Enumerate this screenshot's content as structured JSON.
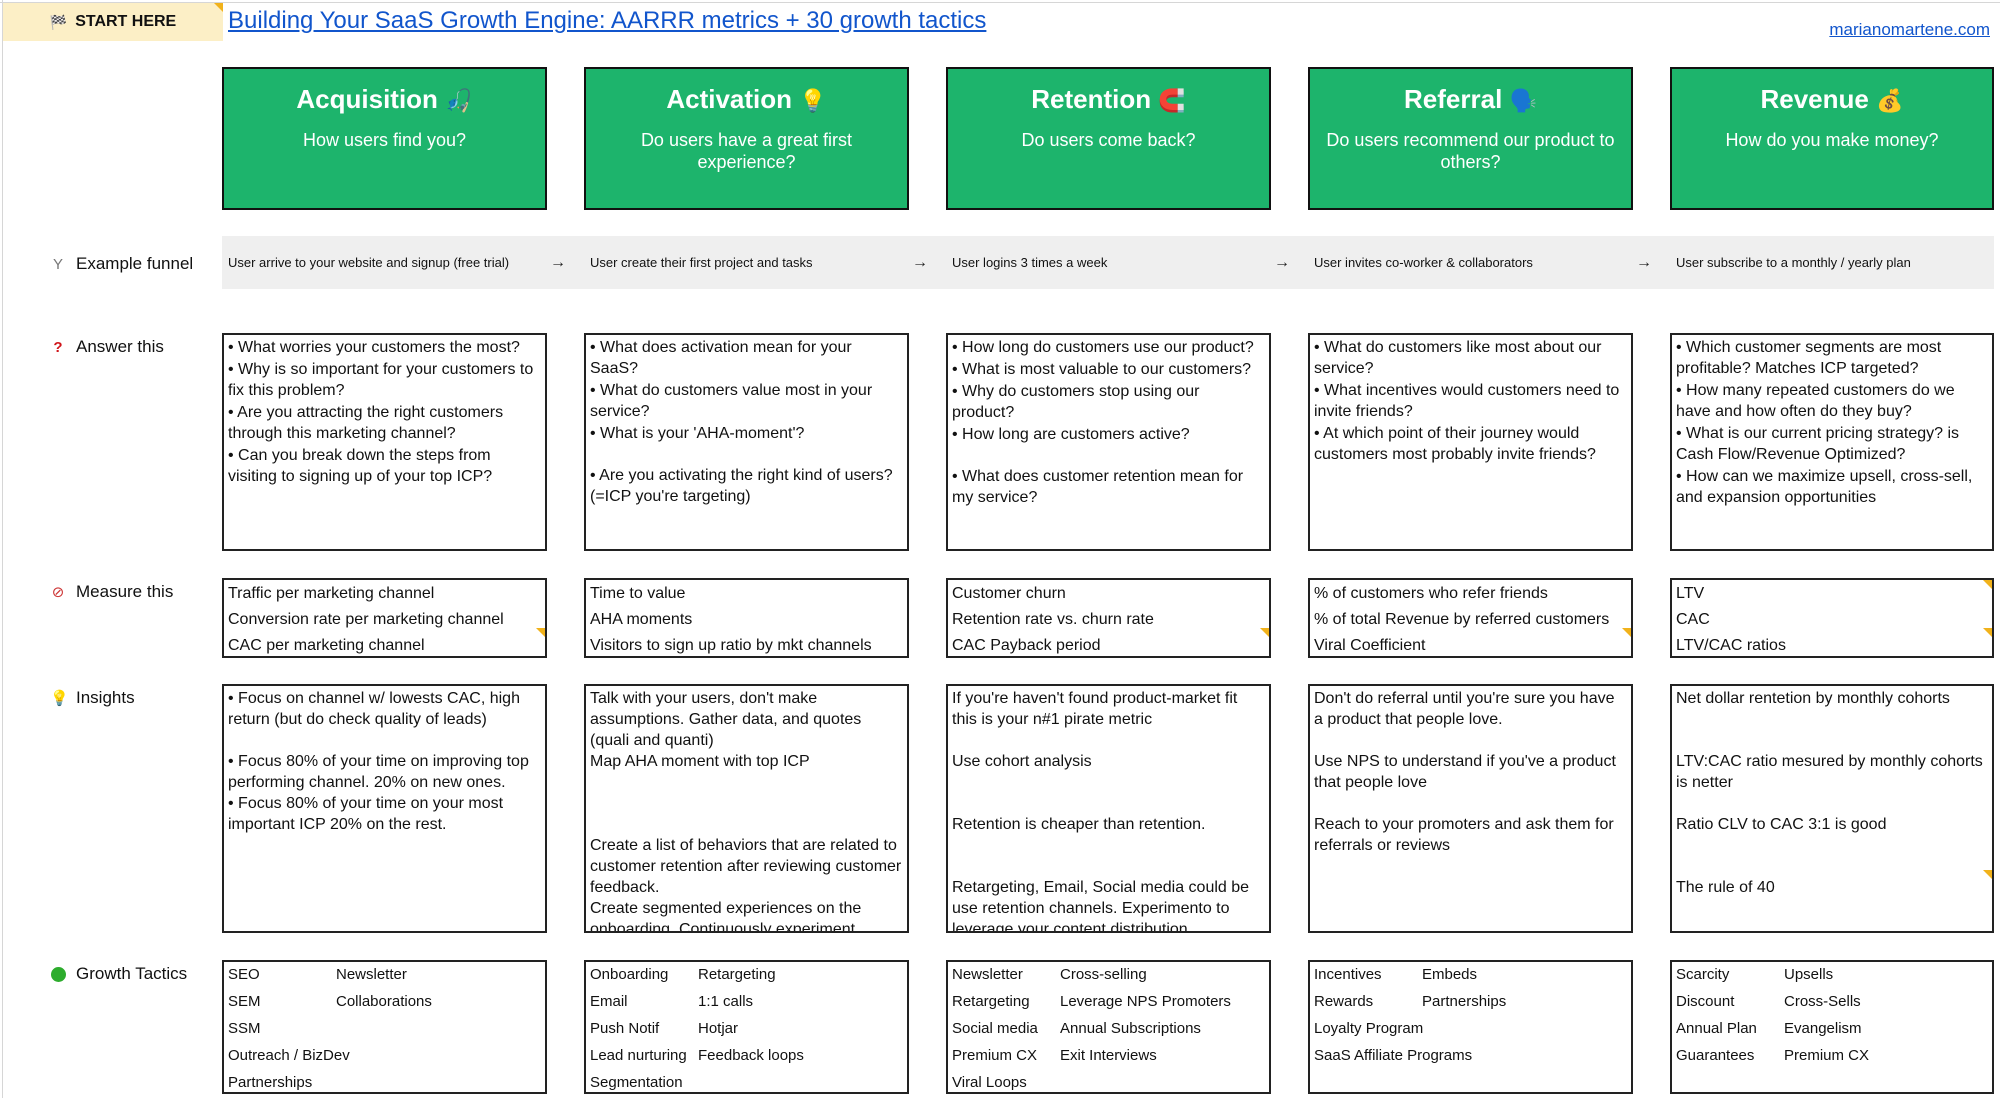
{
  "start_here": {
    "label": "START HERE",
    "icon": "checkered-flag"
  },
  "title": "Building Your SaaS Growth Engine: AARRR metrics + 30 growth tactics",
  "site_link": "marianomartene.com",
  "theme": {
    "card_green": "#1db46c",
    "link_blue": "#1155cc",
    "start_bg": "#fcefc6",
    "note_marker": "#f1b21b",
    "funnel_bg": "#efefef"
  },
  "row_labels": {
    "funnel": {
      "icon": "funnel-icon",
      "label": "Example funnel"
    },
    "answer": {
      "icon": "question-mark-icon",
      "label": "Answer this"
    },
    "measure": {
      "icon": "compass-icon",
      "label": "Measure this"
    },
    "insights": {
      "icon": "lightbulb-icon",
      "label": "Insights"
    },
    "growth": {
      "icon": "green-circle-icon",
      "label": "Growth Tactics"
    }
  },
  "stages": [
    {
      "name": "Acquisition",
      "emoji": "🎣",
      "question": "How users find you?",
      "funnel": "User arrive to your website and signup (free trial)",
      "answer": [
        "• What worries your customers the most?",
        "• Why is so important for your customers to fix this problem?",
        "• Are you attracting the right customers through this marketing channel?",
        "• Can you break down the steps from visiting to signing up of your top ICP?"
      ],
      "measure": [
        "Traffic per marketing channel",
        "Conversion rate per marketing channel",
        "CAC per marketing channel"
      ],
      "insights": [
        "• Focus on channel w/ lowests CAC, high return (but do check quality of leads)",
        "•  Focus 80% of your time on improving top performing channel. 20% on new ones.",
        "•  Focus 80% of your time on your most important ICP 20% on the rest."
      ],
      "tactics": [
        "SEO",
        "Newsletter",
        "SEM",
        "Collaborations",
        "SSM",
        "",
        "Outreach / BizDev",
        "",
        "Partnerships",
        ""
      ]
    },
    {
      "name": "Activation",
      "emoji": "💡",
      "question": "Do users have a great first experience?",
      "funnel": "User create their first project and tasks",
      "answer": [
        "• What does activation mean for your SaaS?",
        "• What do customers value most in your service?",
        "• What is your 'AHA-moment'?",
        "• Are you activating the right kind of users? (=ICP you're targeting)"
      ],
      "measure": [
        "Time to value",
        "AHA moments",
        "Visitors to sign up ratio by mkt channels"
      ],
      "insights": [
        "Talk with your users, don't make assumptions. Gather data, and quotes (quali and quanti)",
        "Map AHA moment with top ICP",
        "Create a list of behaviors that are related to customer retention after reviewing customer feedback.",
        "Create segmented experiences on the onboarding. Continuously experiment."
      ],
      "tactics": [
        "Onboarding",
        "Retargeting",
        "Email",
        "1:1 calls",
        "Push Notif",
        "Hotjar",
        "Lead nurturing",
        "Feedback loops",
        "Segmentation",
        ""
      ]
    },
    {
      "name": "Retention",
      "emoji": "🧲",
      "question": "Do users come back?",
      "funnel": "User logins 3 times a week",
      "answer": [
        "• How long do customers use our product?",
        "• What is most valuable to our customers?",
        "• Why do customers stop using our product?",
        "• How long are customers active?",
        "• What does customer retention mean for my service?"
      ],
      "measure": [
        "Customer churn",
        "Retention rate vs. churn rate",
        "CAC Payback period"
      ],
      "insights": [
        "If you're haven't found product-market fit this is your n#1 pirate metric",
        "Use cohort analysis",
        "Retention is cheaper than retention.",
        "Retargeting, Email, Social media could be use retention channels. Experimento to leverage your content distribution"
      ],
      "tactics": [
        "Newsletter",
        "Cross-selling",
        "Retargeting",
        "Leverage NPS Promoters",
        "Social media",
        "Annual Subscriptions",
        "Premium CX",
        "Exit Interviews",
        "Viral Loops",
        ""
      ]
    },
    {
      "name": "Referral",
      "emoji": "🗣️",
      "question": "Do users recommend our product to others?",
      "funnel": "User invites co-worker & collaborators",
      "answer": [
        "• What do customers like most about our service?",
        "• What incentives would customers need to invite friends?",
        "• At which point of their journey would customers most probably invite friends?"
      ],
      "measure": [
        "% of customers who refer friends",
        "% of total Revenue by referred customers",
        "Viral Coefficient"
      ],
      "insights": [
        "Don't do referral until you're sure you have a product that people love.",
        "Use NPS to understand if you've a product that people love",
        "Reach to your promoters and ask them for referrals or reviews"
      ],
      "tactics": [
        "Incentives",
        "Embeds",
        "Rewards",
        "Partnerships",
        "Loyalty Program",
        "",
        "SaaS Affiliate Programs",
        ""
      ]
    },
    {
      "name": "Revenue",
      "emoji": "💰",
      "question": "How do you make money?",
      "funnel": "User subscribe to a monthly / yearly plan",
      "answer": [
        "• Which customer segments are most profitable? Matches ICP targeted?",
        "• How many repeated customers do we have and how often do they buy?",
        "•  What is our current pricing strategy? is Cash Flow/Revenue Optimized?",
        "• How can we maximize upsell, cross-sell, and expansion opportunities"
      ],
      "measure": [
        "LTV",
        "CAC",
        "LTV/CAC ratios"
      ],
      "insights": [
        "Net dollar rentetion by monthly cohorts",
        "LTV:CAC ratio mesured by monthly cohorts is netter",
        "Ratio CLV to CAC 3:1 is good",
        "The rule of 40"
      ],
      "tactics": [
        "Scarcity",
        "Upsells",
        "Discount",
        "Cross-Sells",
        "Annual Plan",
        "Evangelism",
        "Guarantees",
        "Premium CX"
      ]
    }
  ],
  "funnel_arrow": "→"
}
